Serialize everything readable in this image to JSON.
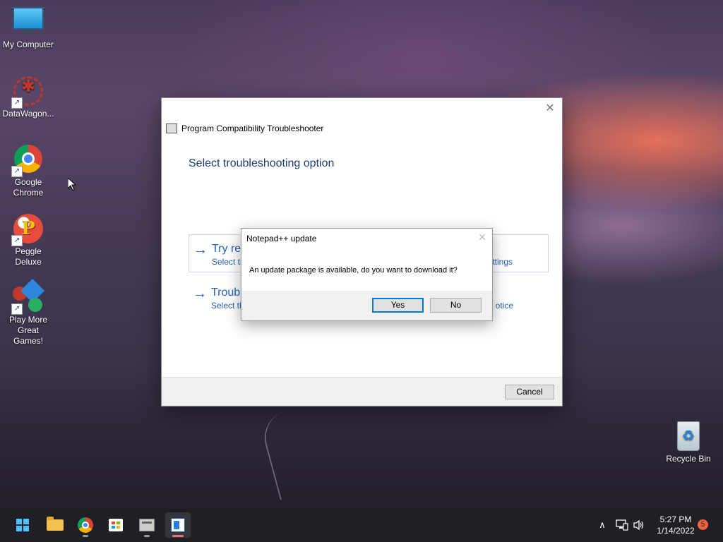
{
  "desktop": {
    "icons": [
      {
        "label": "My Computer",
        "icon": "computer-icon"
      },
      {
        "label": "DataWagon...",
        "icon": "datawagon-icon"
      },
      {
        "label": "Google Chrome",
        "icon": "chrome-icon"
      },
      {
        "label": "Peggle Deluxe",
        "icon": "peggle-icon"
      },
      {
        "label": "Play More Great Games!",
        "icon": "games-icon"
      },
      {
        "label": "Recycle Bin",
        "icon": "recycle-bin-icon"
      }
    ]
  },
  "troubleshooter": {
    "title": "Program Compatibility Troubleshooter",
    "heading": "Select troubleshooting option",
    "options": [
      {
        "title": "Try rec",
        "desc": "Select th",
        "desc_right": "ttings"
      },
      {
        "title": "Troubl",
        "desc": "Select th",
        "desc_right": "otice"
      }
    ],
    "cancel_label": "Cancel",
    "close_glyph": "✕"
  },
  "update_dialog": {
    "title": "Notepad++ update",
    "message": "An update package is available, do you want to download it?",
    "yes_label": "Yes",
    "no_label": "No",
    "close_glyph": "✕"
  },
  "taskbar": {
    "apps": [
      "start-icon",
      "file-explorer-icon",
      "chrome-icon",
      "store-icon",
      "troubleshooter-icon",
      "notepadpp-icon"
    ],
    "time": "5:27 PM",
    "date": "1/14/2022",
    "notification_count": "5",
    "tray_up_glyph": "∧",
    "tray_volume_glyph": "🔈"
  },
  "colors": {
    "link_blue": "#1f5fbf",
    "heading_blue": "#1a3d73",
    "accent": "#0078d7"
  }
}
